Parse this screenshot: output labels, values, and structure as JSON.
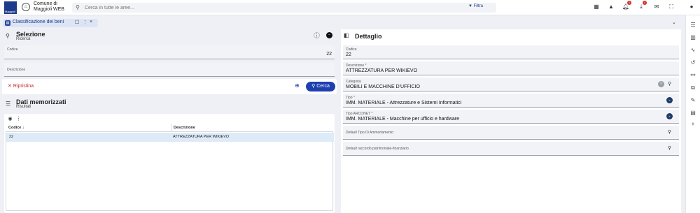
{
  "header": {
    "logo_text": "Maggioli",
    "town_name": "Comune di Maggioli WEB",
    "search_placeholder": "Cerca in tutte le aree...",
    "filter_label": "Filtra",
    "notifications_badge": "1",
    "downloads_badge": "1"
  },
  "tab": {
    "label": "Classificazione dei beni",
    "pin_glyph": "☐",
    "more_glyph": "⋮",
    "close_glyph": "×"
  },
  "left": {
    "selezione": {
      "title": "Selezione",
      "subtitle": "Ricerca"
    },
    "codice": {
      "label": "Codice",
      "value": "22"
    },
    "descrizione": {
      "label": "Descrizione",
      "value": ""
    },
    "reset_label": "Ripristina",
    "search_label": "Cerca",
    "dati": {
      "title": "Dati memorizzati",
      "subtitle": "Risultati"
    },
    "grid": {
      "columns": [
        "Codice",
        "Descrizione"
      ],
      "sort_indicator": "↓",
      "rows": [
        {
          "codice": "22",
          "descrizione": "ATTREZZATURA PER WIKIEVO"
        }
      ]
    }
  },
  "right": {
    "title": "Dettaglio",
    "fields": {
      "codice": {
        "label": "Codice",
        "value": "22"
      },
      "descrizione": {
        "label": "Descrizione",
        "value": "ATTREZZATURA PER WIKIEVO"
      },
      "categoria": {
        "label": "Categoria",
        "value": "MOBILI E MACCHINE D'UFFICIO"
      },
      "tipo": {
        "label": "Tipo",
        "value": "IMM. MATERIALE - Attrezzature e Sistemi Informatici"
      },
      "tipo_arconet": {
        "label": "Tipo ARCONET",
        "value": "IMM. MATERIALE - Macchine per ufficio e hardware"
      },
      "default_tipo": {
        "label": "Default Tipo Di Ammortamento",
        "value": ""
      },
      "default_raccordo": {
        "label": "Default raccordo patrimoniale-finanziario",
        "value": ""
      }
    }
  },
  "colors": {
    "brand": "#1e3a8a",
    "accent": "#1e40af",
    "danger": "#c62828",
    "selected_row": "#ddeaf7"
  }
}
